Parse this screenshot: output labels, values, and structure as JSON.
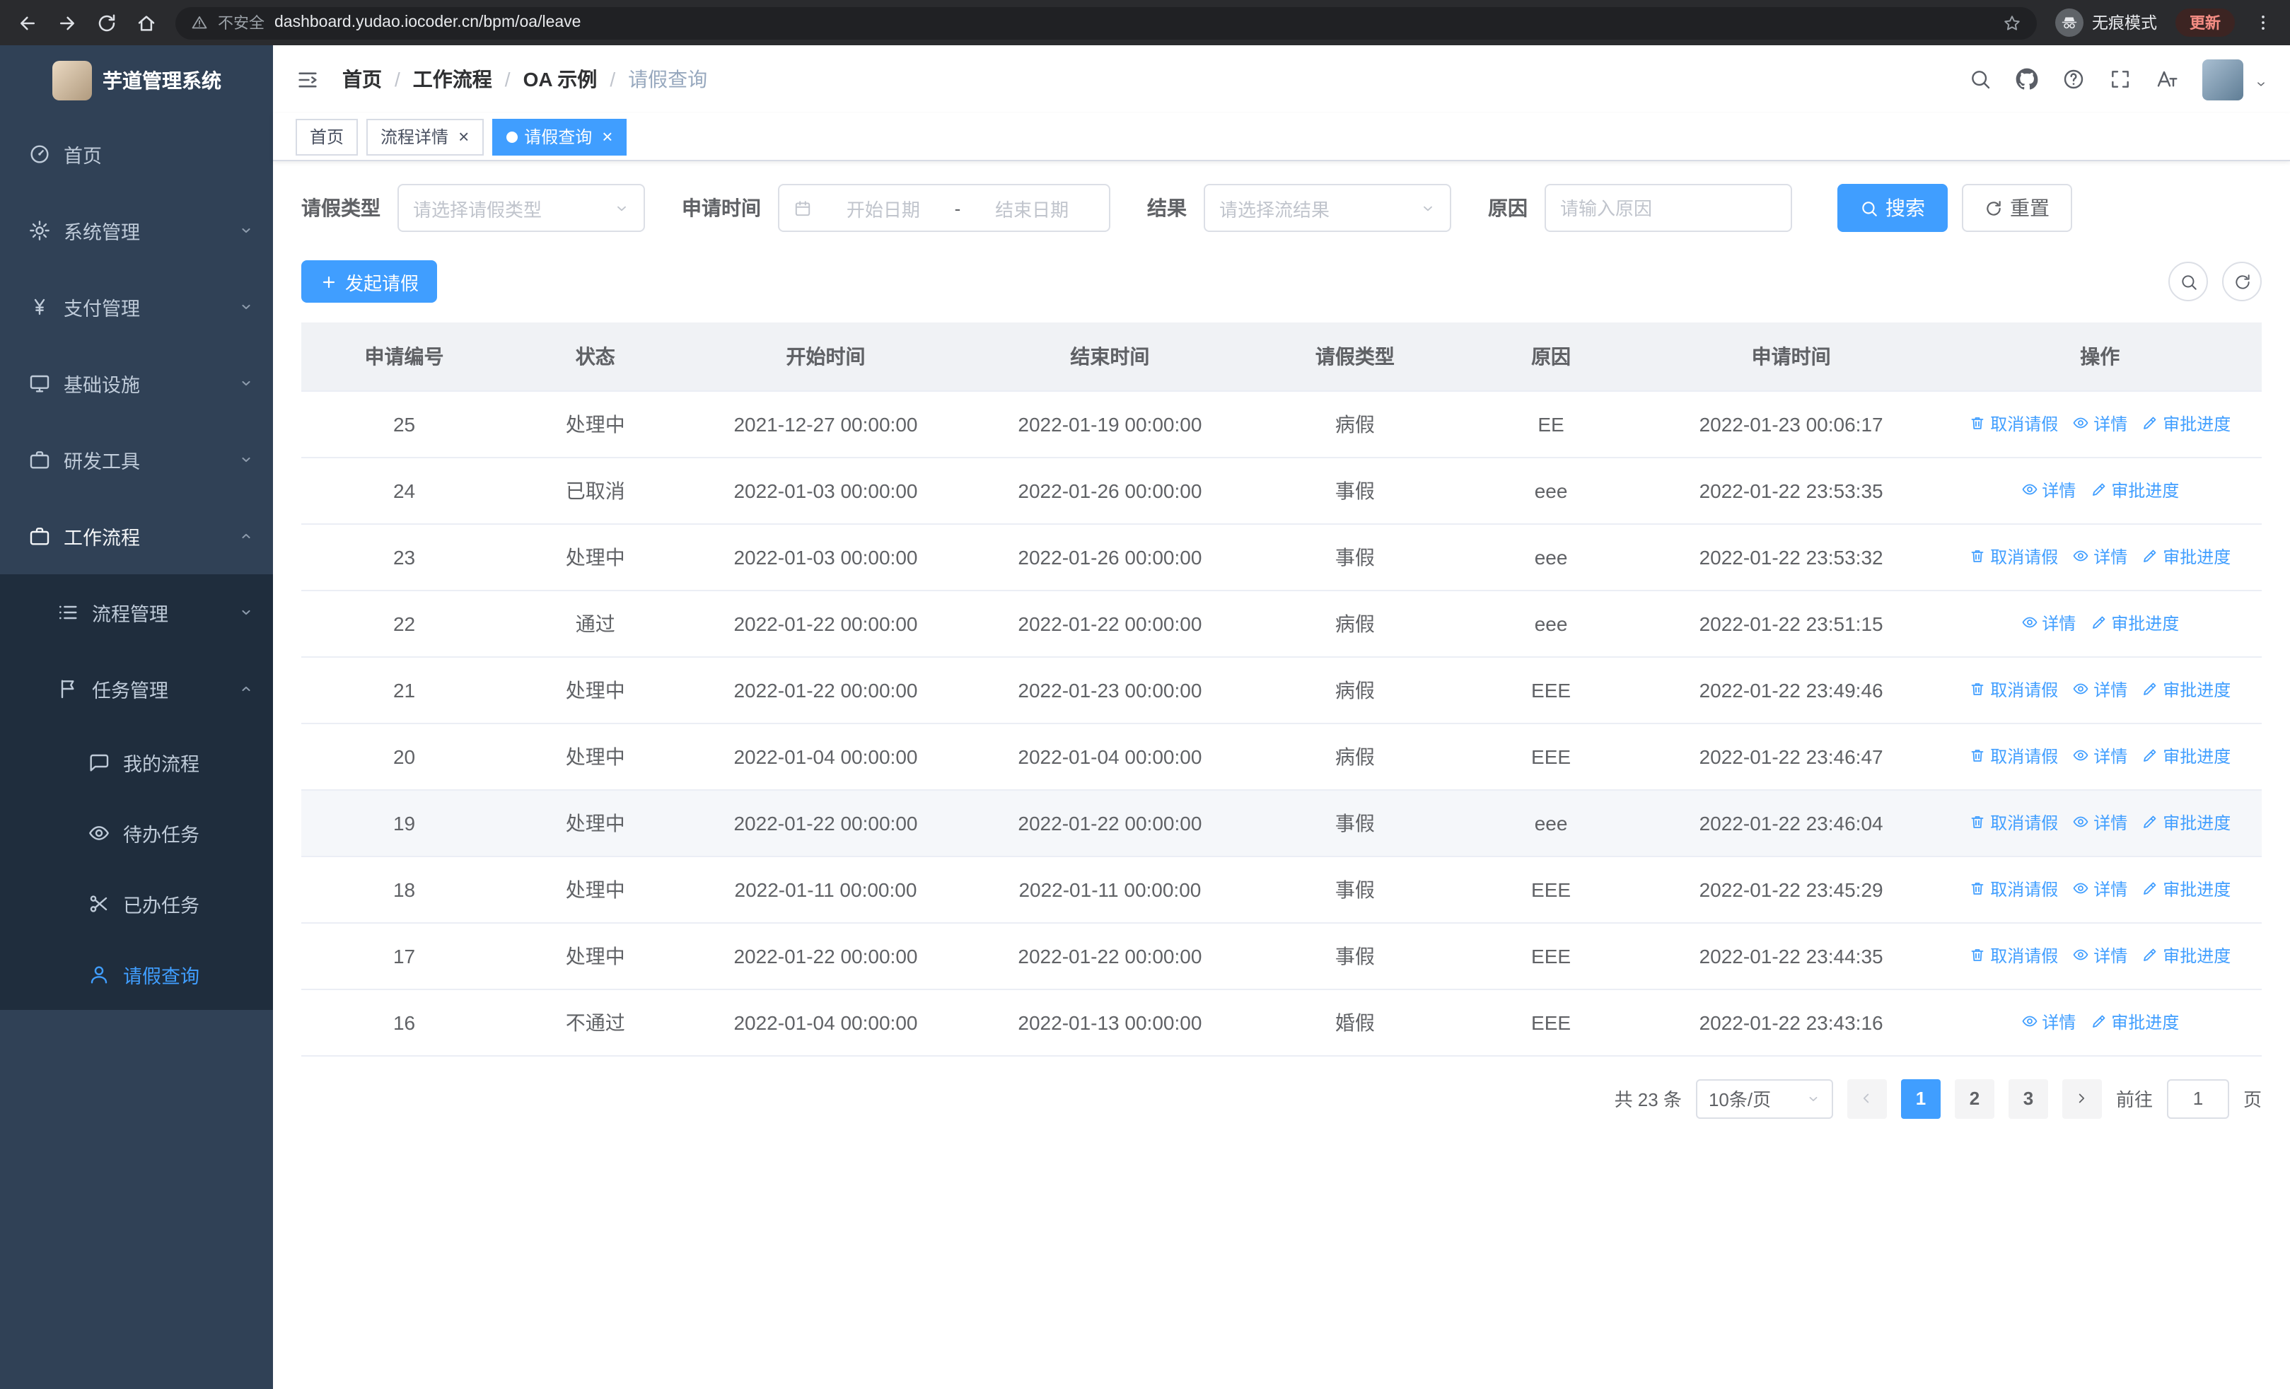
{
  "browser": {
    "security_label": "不安全",
    "url": "dashboard.yudao.iocoder.cn/bpm/oa/leave",
    "incognito_label": "无痕模式",
    "update_label": "更新"
  },
  "sidebar": {
    "title": "芋道管理系统",
    "menu": [
      {
        "name": "home",
        "label": "首页",
        "icon": "dashboard",
        "level": 1
      },
      {
        "name": "system",
        "label": "系统管理",
        "icon": "gear",
        "level": 1,
        "chevron": "down"
      },
      {
        "name": "payment",
        "label": "支付管理",
        "icon": "yen",
        "level": 1,
        "chevron": "down"
      },
      {
        "name": "infrastructure",
        "label": "基础设施",
        "icon": "monitor",
        "level": 1,
        "chevron": "down"
      },
      {
        "name": "devtools",
        "label": "研发工具",
        "icon": "briefcase",
        "level": 1,
        "chevron": "down"
      },
      {
        "name": "workflow",
        "label": "工作流程",
        "icon": "briefcase",
        "level": 1,
        "chevron": "up",
        "active_parent": true
      },
      {
        "name": "process-management",
        "label": "流程管理",
        "icon": "list",
        "level": 2,
        "sub": true,
        "chevron": "down"
      },
      {
        "name": "task-management",
        "label": "任务管理",
        "icon": "flag",
        "level": 2,
        "sub": true,
        "chevron": "up"
      },
      {
        "name": "my-process",
        "label": "我的流程",
        "icon": "chat",
        "level": 3,
        "sub": true
      },
      {
        "name": "todo-tasks",
        "label": "待办任务",
        "icon": "eye",
        "level": 3,
        "sub": true
      },
      {
        "name": "done-tasks",
        "label": "已办任务",
        "icon": "scissors",
        "level": 3,
        "sub": true
      },
      {
        "name": "leave-query",
        "label": "请假查询",
        "icon": "person",
        "level": 3,
        "sub": true,
        "active": true
      }
    ]
  },
  "header": {
    "breadcrumb": [
      "首页",
      "工作流程",
      "OA 示例",
      "请假查询"
    ],
    "breadcrumb_separator": "/"
  },
  "tabs": [
    {
      "name": "home",
      "label": "首页",
      "closable": false,
      "active": false
    },
    {
      "name": "process-detail",
      "label": "流程详情",
      "closable": true,
      "active": false
    },
    {
      "name": "leave-query",
      "label": "请假查询",
      "closable": true,
      "active": true
    }
  ],
  "filters": {
    "leave_type_label": "请假类型",
    "leave_type_placeholder": "请选择请假类型",
    "apply_time_label": "申请时间",
    "date_start_placeholder": "开始日期",
    "date_separator": "-",
    "date_end_placeholder": "结束日期",
    "result_label": "结果",
    "result_placeholder": "请选择流结果",
    "reason_label": "原因",
    "reason_placeholder": "请输入原因",
    "search_button": "搜索",
    "reset_button": "重置"
  },
  "toolbar": {
    "create_button": "发起请假"
  },
  "table": {
    "columns": [
      "申请编号",
      "状态",
      "开始时间",
      "结束时间",
      "请假类型",
      "原因",
      "申请时间",
      "操作"
    ],
    "actions": {
      "cancel": "取消请假",
      "detail": "详情",
      "progress": "审批进度"
    },
    "rows": [
      {
        "id": "25",
        "status": "处理中",
        "start": "2021-12-27 00:00:00",
        "end": "2022-01-19 00:00:00",
        "type": "病假",
        "reason": "EE",
        "applied": "2022-01-23 00:06:17",
        "can_cancel": true
      },
      {
        "id": "24",
        "status": "已取消",
        "start": "2022-01-03 00:00:00",
        "end": "2022-01-26 00:00:00",
        "type": "事假",
        "reason": "eee",
        "applied": "2022-01-22 23:53:35",
        "can_cancel": false
      },
      {
        "id": "23",
        "status": "处理中",
        "start": "2022-01-03 00:00:00",
        "end": "2022-01-26 00:00:00",
        "type": "事假",
        "reason": "eee",
        "applied": "2022-01-22 23:53:32",
        "can_cancel": true
      },
      {
        "id": "22",
        "status": "通过",
        "start": "2022-01-22 00:00:00",
        "end": "2022-01-22 00:00:00",
        "type": "病假",
        "reason": "eee",
        "applied": "2022-01-22 23:51:15",
        "can_cancel": false
      },
      {
        "id": "21",
        "status": "处理中",
        "start": "2022-01-22 00:00:00",
        "end": "2022-01-23 00:00:00",
        "type": "病假",
        "reason": "EEE",
        "applied": "2022-01-22 23:49:46",
        "can_cancel": true
      },
      {
        "id": "20",
        "status": "处理中",
        "start": "2022-01-04 00:00:00",
        "end": "2022-01-04 00:00:00",
        "type": "病假",
        "reason": "EEE",
        "applied": "2022-01-22 23:46:47",
        "can_cancel": true
      },
      {
        "id": "19",
        "status": "处理中",
        "start": "2022-01-22 00:00:00",
        "end": "2022-01-22 00:00:00",
        "type": "事假",
        "reason": "eee",
        "applied": "2022-01-22 23:46:04",
        "can_cancel": true,
        "highlighted": true
      },
      {
        "id": "18",
        "status": "处理中",
        "start": "2022-01-11 00:00:00",
        "end": "2022-01-11 00:00:00",
        "type": "事假",
        "reason": "EEE",
        "applied": "2022-01-22 23:45:29",
        "can_cancel": true
      },
      {
        "id": "17",
        "status": "处理中",
        "start": "2022-01-22 00:00:00",
        "end": "2022-01-22 00:00:00",
        "type": "事假",
        "reason": "EEE",
        "applied": "2022-01-22 23:44:35",
        "can_cancel": true
      },
      {
        "id": "16",
        "status": "不通过",
        "start": "2022-01-04 00:00:00",
        "end": "2022-01-13 00:00:00",
        "type": "婚假",
        "reason": "EEE",
        "applied": "2022-01-22 23:43:16",
        "can_cancel": false
      }
    ]
  },
  "pagination": {
    "total_label": "共 23 条",
    "page_size_label": "10条/页",
    "pages": [
      "1",
      "2",
      "3"
    ],
    "active_page": "1",
    "jump_prefix": "前往",
    "jump_value": "1",
    "jump_suffix": "页"
  },
  "colors": {
    "primary": "#409EFF",
    "sidebar_bg": "#304156",
    "sidebar_sub_bg": "#1f2d3d",
    "sidebar_text": "#bfcbd9"
  }
}
